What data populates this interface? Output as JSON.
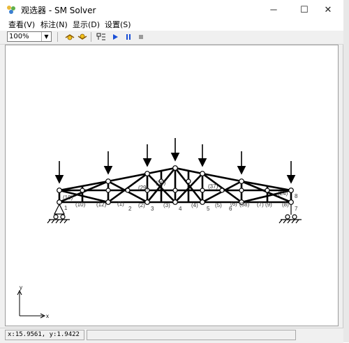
{
  "window": {
    "title": "观选器 - SM Solver"
  },
  "controls": {
    "minimize": "─",
    "maximize": "☐",
    "close": "✕"
  },
  "menu": [
    "查看(V)",
    "标注(N)",
    "显示(D)",
    "设置(S)"
  ],
  "toolbar": {
    "zoom_value": "100%"
  },
  "status": {
    "coords": "x:15.9561, y:1.9422"
  },
  "axes": {
    "x": "x",
    "y": "y"
  },
  "node_labels": [
    "1",
    "2",
    "3",
    "4",
    "5",
    "6",
    "7",
    "8"
  ],
  "member_labels": [
    "(1)",
    "(2)",
    "(3)",
    "(4)",
    "(5)",
    "(6)",
    "(7)",
    "(8)",
    "(9)",
    "(10)",
    "(12)",
    "(18)",
    "(24)",
    "(29)",
    "(30)",
    "(37)",
    "(38)"
  ],
  "colors": {
    "accent_play": "#1a4fd6",
    "structure": "#000000"
  }
}
